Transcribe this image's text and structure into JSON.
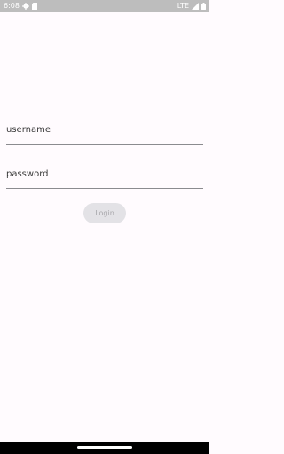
{
  "status_bar": {
    "time": "6:08",
    "network": "LTE",
    "icons": [
      "settings-gear-icon",
      "sd-card-icon",
      "signal-icon",
      "battery-icon"
    ]
  },
  "form": {
    "username_placeholder": "username",
    "password_placeholder": "password",
    "login_label": "Login"
  },
  "colors": {
    "background": "#fffbfe",
    "status_bar": "#bdbdbd",
    "button_bg": "#e3e2e6",
    "button_text": "#a8a7ab"
  }
}
